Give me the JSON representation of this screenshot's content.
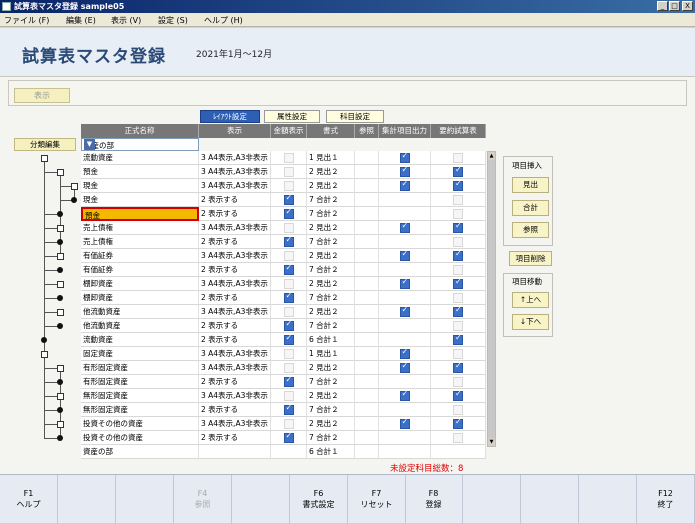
{
  "window": {
    "title": "試算表マスタ登録 sample05",
    "minimize": "_",
    "maximize": "□",
    "close": "X"
  },
  "menu": [
    {
      "label": "ファイル (F)"
    },
    {
      "label": "編集 (E)"
    },
    {
      "label": "表示 (V)"
    },
    {
      "label": "設定 (S)"
    },
    {
      "label": "ヘルプ (H)"
    }
  ],
  "header": {
    "title": "試算表マスタ登録",
    "period": "2021年1月～12月"
  },
  "view_button": "表示",
  "tabs": [
    {
      "label": "ﾚｲｱｳﾄ設定",
      "active": true
    },
    {
      "label": "属性設定",
      "active": false
    },
    {
      "label": "科目設定",
      "active": false
    }
  ],
  "columns": {
    "name": "正式名称",
    "display": "表示",
    "amount": "金額表示",
    "format": "書式",
    "ref": "参照",
    "aggregate": "集計項目出力",
    "summary": "要約試算表"
  },
  "bunrui_button": "分類編集",
  "section_select": {
    "value": "資産の部"
  },
  "rows": [
    {
      "name": "流動資産",
      "display": "3 A4表示,A3非表示",
      "amt": "off",
      "format": "1 見出１",
      "agg": "on",
      "sum": "off"
    },
    {
      "name": "預金",
      "display": "3 A4表示,A3非表示",
      "amt": "off",
      "format": "2 見出２",
      "agg": "on",
      "sum": "on"
    },
    {
      "name": "現金",
      "display": "3 A4表示,A3非表示",
      "amt": "off",
      "format": "2 見出２",
      "agg": "on",
      "sum": "on"
    },
    {
      "name": "現金",
      "display": "2 表示する",
      "amt": "on",
      "format": "7 合計２",
      "agg": "",
      "sum": "off"
    },
    {
      "name": "預金",
      "display": "2 表示する",
      "amt": "on",
      "format": "7 合計２",
      "agg": "",
      "sum": "off",
      "selected": true
    },
    {
      "name": "売上債権",
      "display": "3 A4表示,A3非表示",
      "amt": "off",
      "format": "2 見出２",
      "agg": "on",
      "sum": "on"
    },
    {
      "name": "売上債権",
      "display": "2 表示する",
      "amt": "on",
      "format": "7 合計２",
      "agg": "",
      "sum": "off"
    },
    {
      "name": "有価証券",
      "display": "3 A4表示,A3非表示",
      "amt": "off",
      "format": "2 見出２",
      "agg": "on",
      "sum": "on"
    },
    {
      "name": "有価証券",
      "display": "2 表示する",
      "amt": "on",
      "format": "7 合計２",
      "agg": "",
      "sum": "off"
    },
    {
      "name": "棚卸資産",
      "display": "3 A4表示,A3非表示",
      "amt": "off",
      "format": "2 見出２",
      "agg": "on",
      "sum": "on"
    },
    {
      "name": "棚卸資産",
      "display": "2 表示する",
      "amt": "on",
      "format": "7 合計２",
      "agg": "",
      "sum": "off"
    },
    {
      "name": "他流動資産",
      "display": "3 A4表示,A3非表示",
      "amt": "off",
      "format": "2 見出２",
      "agg": "on",
      "sum": "on"
    },
    {
      "name": "他流動資産",
      "display": "2 表示する",
      "amt": "on",
      "format": "7 合計２",
      "agg": "",
      "sum": "off"
    },
    {
      "name": "流動資産",
      "display": "2 表示する",
      "amt": "on",
      "format": "6 合計１",
      "agg": "",
      "sum": "on"
    },
    {
      "name": "固定資産",
      "display": "3 A4表示,A3非表示",
      "amt": "off",
      "format": "1 見出１",
      "agg": "on",
      "sum": "off"
    },
    {
      "name": "有形固定資産",
      "display": "3 A4表示,A3非表示",
      "amt": "off",
      "format": "2 見出２",
      "agg": "on",
      "sum": "on"
    },
    {
      "name": "有形固定資産",
      "display": "2 表示する",
      "amt": "on",
      "format": "7 合計２",
      "agg": "",
      "sum": "off"
    },
    {
      "name": "無形固定資産",
      "display": "3 A4表示,A3非表示",
      "amt": "off",
      "format": "2 見出２",
      "agg": "on",
      "sum": "on"
    },
    {
      "name": "無形固定資産",
      "display": "2 表示する",
      "amt": "on",
      "format": "7 合計２",
      "agg": "",
      "sum": "off"
    },
    {
      "name": "投資その他の資産",
      "display": "3 A4表示,A3非表示",
      "amt": "off",
      "format": "2 見出２",
      "agg": "on",
      "sum": "on"
    },
    {
      "name": "投資その他の資産",
      "display": "2 表示する",
      "amt": "on",
      "format": "7 合計２",
      "agg": "",
      "sum": "off"
    },
    {
      "name": "資産の部",
      "display": "",
      "amt": "",
      "format": "6 合計１",
      "agg": "",
      "sum": ""
    }
  ],
  "side_panel": {
    "insert_title": "項目挿入",
    "insert_buttons": [
      "見出",
      "合計",
      "参照"
    ],
    "delete_button": "項目削除",
    "move_title": "項目移動",
    "move_buttons": [
      "↑上へ",
      "↓下へ"
    ]
  },
  "unset_count": "未設定科目総数：8",
  "fkeys": [
    {
      "key": "F1",
      "label": "ヘルプ",
      "enabled": true
    },
    {
      "key": "",
      "label": "",
      "enabled": true
    },
    {
      "key": "",
      "label": "",
      "enabled": true
    },
    {
      "key": "F4",
      "label": "参照",
      "enabled": false
    },
    {
      "key": "",
      "label": "",
      "enabled": true
    },
    {
      "key": "F6",
      "label": "書式設定",
      "enabled": true
    },
    {
      "key": "F7",
      "label": "リセット",
      "enabled": true
    },
    {
      "key": "F8",
      "label": "登録",
      "enabled": true
    },
    {
      "key": "",
      "label": "",
      "enabled": true
    },
    {
      "key": "",
      "label": "",
      "enabled": true
    },
    {
      "key": "",
      "label": "",
      "enabled": true
    },
    {
      "key": "F12",
      "label": "終了",
      "enabled": true
    }
  ]
}
